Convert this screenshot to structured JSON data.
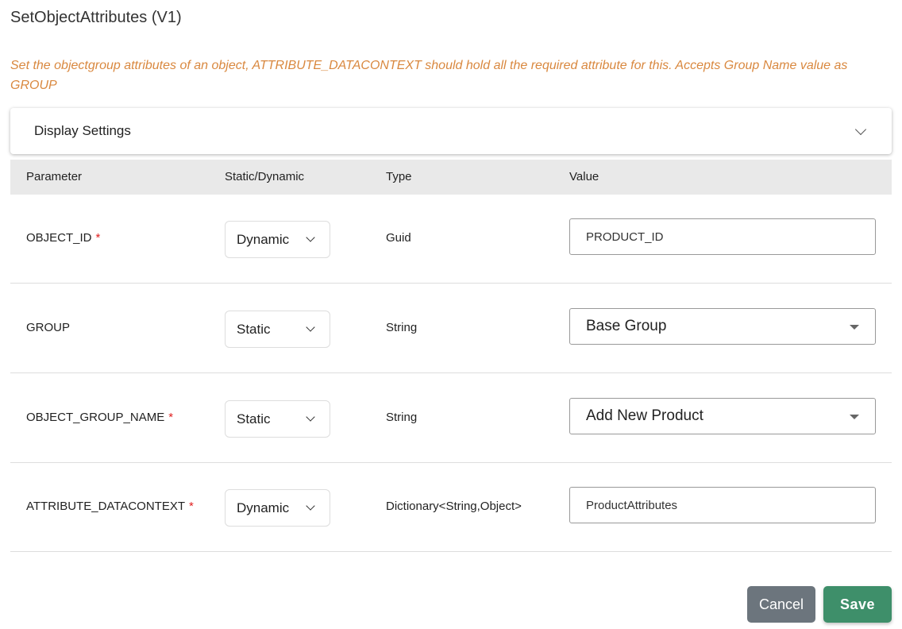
{
  "title": "SetObjectAttributes (V1)",
  "description": "Set the objectgroup attributes of an object, ATTRIBUTE_DATACONTEXT should hold all the required attribute for this. Accepts Group Name value as GROUP",
  "display_settings": "Display Settings",
  "headers": {
    "parameter": "Parameter",
    "mode": "Static/Dynamic",
    "type": "Type",
    "value": "Value"
  },
  "rows": [
    {
      "param": "OBJECT_ID",
      "required": "*",
      "mode": "Dynamic",
      "type": "Guid",
      "value": "PRODUCT_ID"
    },
    {
      "param": "GROUP",
      "required": "",
      "mode": "Static",
      "type": "String",
      "value": "Base Group"
    },
    {
      "param": "OBJECT_GROUP_NAME",
      "required": "*",
      "mode": "Static",
      "type": "String",
      "value": "Add New Product"
    },
    {
      "param": "ATTRIBUTE_DATACONTEXT",
      "required": "*",
      "mode": "Dynamic",
      "type": "Dictionary<String,Object>",
      "value": "ProductAttributes"
    }
  ],
  "buttons": {
    "cancel": "Cancel",
    "save": "Save"
  }
}
